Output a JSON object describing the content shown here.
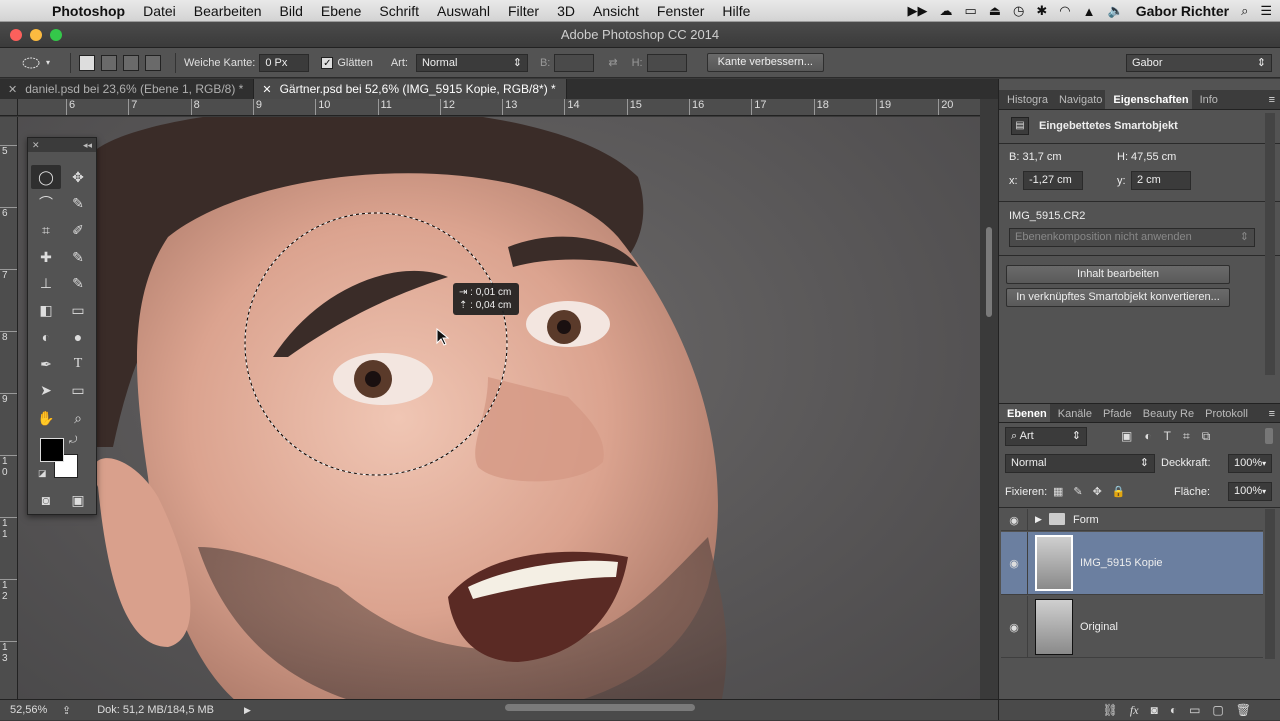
{
  "menubar": {
    "app": "Photoshop",
    "items": [
      "Datei",
      "Bearbeiten",
      "Bild",
      "Ebene",
      "Schrift",
      "Auswahl",
      "Filter",
      "3D",
      "Ansicht",
      "Fenster",
      "Hilfe"
    ],
    "user": "Gabor Richter"
  },
  "window": {
    "title": "Adobe Photoshop CC 2014"
  },
  "options": {
    "feather_label": "Weiche Kante:",
    "feather_value": "0 Px",
    "antialias_label": "Glätten",
    "style_label": "Art:",
    "style_value": "Normal",
    "width_label": "B:",
    "height_label": "H:",
    "refine_button": "Kante verbessern...",
    "workspace": "Gabor"
  },
  "tabs": [
    {
      "label": "daniel.psd bei 23,6% (Ebene 1, RGB/8) *"
    },
    {
      "label": "Gärtner.psd bei 52,6% (IMG_5915 Kopie, RGB/8*) *"
    }
  ],
  "ruler": {
    "h": [
      "6",
      "7",
      "8",
      "9",
      "10",
      "11",
      "12",
      "13",
      "14",
      "15",
      "16",
      "17",
      "18",
      "19",
      "20"
    ],
    "v": [
      "5",
      "6",
      "7",
      "8",
      "9",
      "1 0",
      "1 1",
      "1 2",
      "1 3"
    ]
  },
  "tooltip": {
    "line1": "⇥ : 0,01 cm",
    "line2": "⇡ : 0,04 cm"
  },
  "status": {
    "zoom": "52,56%",
    "doc": "Dok: 51,2 MB/184,5 MB"
  },
  "properties": {
    "tabs": [
      "Histogra",
      "Navigato",
      "Eigenschaften",
      "Info"
    ],
    "type": "Eingebettetes Smartobjekt",
    "b": "B: 31,7 cm",
    "h": "H: 47,55 cm",
    "x_label": "x:",
    "x_value": "-1,27 cm",
    "y_label": "y:",
    "y_value": "2 cm",
    "file": "IMG_5915.CR2",
    "comp": "Ebenenkomposition nicht anwenden",
    "edit_button": "Inhalt bearbeiten",
    "convert_button": "In verknüpftes Smartobjekt konvertieren..."
  },
  "layers": {
    "tabs": [
      "Ebenen",
      "Kanäle",
      "Pfade",
      "Beauty Re",
      "Protokoll"
    ],
    "filter": "Art",
    "blend": "Normal",
    "opacity_label": "Deckkraft:",
    "opacity": "100%",
    "lock_label": "Fixieren:",
    "fill_label": "Fläche:",
    "fill": "100%",
    "items": [
      {
        "name": "Form"
      },
      {
        "name": "IMG_5915 Kopie"
      },
      {
        "name": "Original"
      }
    ]
  }
}
